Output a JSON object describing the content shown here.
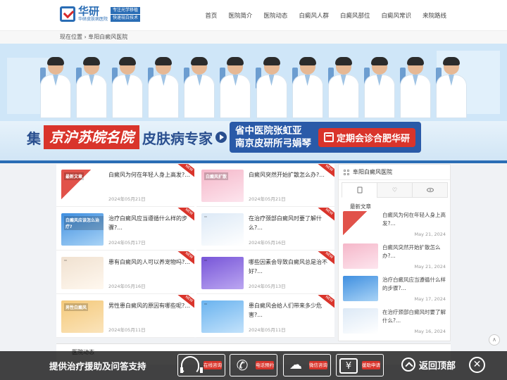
{
  "header": {
    "logo": {
      "name": "华研",
      "sub": "华研皮肤病医院",
      "tag1": "专注光学移植",
      "tag2": "快速祛白技术"
    },
    "nav": [
      "首页",
      "医院简介",
      "医院动态",
      "白癜风人群",
      "白癜风部位",
      "白癜风常识",
      "来院路线"
    ]
  },
  "breadcrumb": "现在位置 › 阜阳白癜风医院",
  "banner": {
    "prefix": "集",
    "highlight": "京沪苏皖名院",
    "suffix": "皮肤病专家",
    "line1": "省中医院张虹亚",
    "line2": "南京皮研所弓娟琴",
    "date_cta": "定期会诊合肥华研"
  },
  "articles": [
    {
      "title": "白癜风为何在年轻人身上高发?...",
      "date": "2024年05月21日",
      "thumb": "thumb-a",
      "cap": "最新文章"
    },
    {
      "title": "白癜风突然开始扩散怎么办?...",
      "date": "2024年05月21日",
      "thumb": "thumb-b",
      "cap": "白癜风扩散"
    },
    {
      "title": "治疗白癜风应当遵循什么样的步骤?...",
      "date": "2024年05月17日",
      "thumb": "thumb-c",
      "cap": "白癜风应该怎么治疗?"
    },
    {
      "title": "在治疗颈部白癜风时要了解什么?...",
      "date": "2024年05月16日",
      "thumb": "thumb-d",
      "cap": ""
    },
    {
      "title": "患有白癜风的人可以养宠物吗?...",
      "date": "2024年05月16日",
      "thumb": "thumb-e",
      "cap": ""
    },
    {
      "title": "哪些因素会导致白癜风总是治不好?...",
      "date": "2024年05月13日",
      "thumb": "thumb-f",
      "cap": ""
    },
    {
      "title": "男性患白癜风的原因有哪些呢?...",
      "date": "2024年05月11日",
      "thumb": "thumb-g",
      "cap": "男性白癜风"
    },
    {
      "title": "患白癜风会给人们带来多少危害?...",
      "date": "2024年05月11日",
      "thumb": "thumb-h",
      "cap": ""
    }
  ],
  "new_badge": "NEW",
  "sidebar": {
    "title": "阜阳白癜风医院",
    "subtitle": "最新文章",
    "items": [
      {
        "title": "白癜风为何在年轻人身上高发?...",
        "date": "May 21, 2024",
        "thumb": "thumb-a"
      },
      {
        "title": "白癜风突然开始扩散怎么办?...",
        "date": "May 21, 2024",
        "thumb": "thumb-b"
      },
      {
        "title": "治疗白癜风应当遵循什么样的步骤?...",
        "date": "May 17, 2024",
        "thumb": "thumb-c"
      },
      {
        "title": "在治疗颈部白癜风时要了解什么?...",
        "date": "May 16, 2024",
        "thumb": "thumb-d"
      }
    ]
  },
  "section2": {
    "title": "医院动态"
  },
  "bottom_bar": {
    "text": "提供治疗援助及问答支持",
    "btn1": "在线咨询",
    "btn2": "电话预约",
    "btn3": "微信咨询",
    "btn4": "援助申请",
    "back_top": "返回顶部",
    "close": "✕"
  },
  "colors": {
    "brand": "#2a6db5",
    "accent": "#d9342b"
  }
}
